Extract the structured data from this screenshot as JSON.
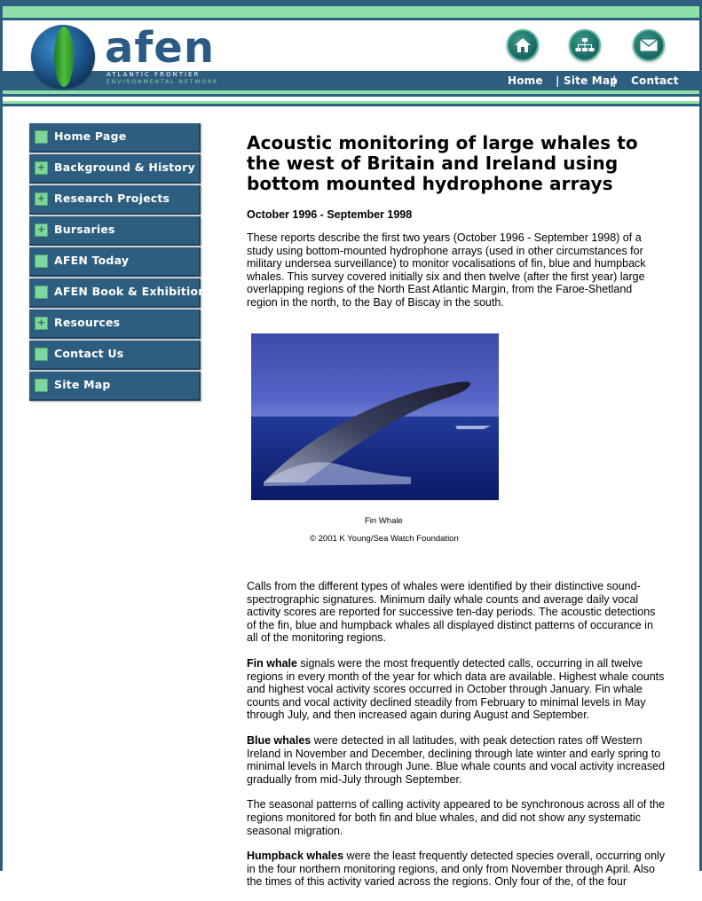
{
  "header": {
    "logo_text": "afen",
    "logo_sub1": "ATLANTIC FRONTIER",
    "logo_sub2": "ENVIRONMENTAL NETWORK",
    "icons": [
      "home-icon",
      "sitemap-icon",
      "mail-icon"
    ],
    "nav": {
      "home": "Home",
      "sep1": "|",
      "site_map": "Site Map",
      "sep2": "|",
      "contact": "Contact"
    },
    "colors": {
      "band": "#2e5e7f",
      "accent_green": "#8fe0a8"
    }
  },
  "sidebar": {
    "items": [
      {
        "label": "Home Page",
        "marker": ""
      },
      {
        "label": "Background & History",
        "marker": "+"
      },
      {
        "label": "Research Projects",
        "marker": "+"
      },
      {
        "label": "Bursaries",
        "marker": "+"
      },
      {
        "label": "AFEN Today",
        "marker": ""
      },
      {
        "label": "AFEN Book & Exhibition",
        "marker": ""
      },
      {
        "label": "Resources",
        "marker": "+"
      },
      {
        "label": "Contact Us",
        "marker": ""
      },
      {
        "label": "Site Map",
        "marker": ""
      }
    ]
  },
  "main": {
    "title": "Acoustic monitoring of large whales to the west of Britain and Ireland using bottom mounted hydrophone arrays",
    "date": "October 1996 - September 1998",
    "intro": "These reports describe the first two years (October 1996 - September 1998) of a study using bottom-mounted hydrophone arrays (used in other circumstances for military undersea surveillance) to monitor vocalisations of fin, blue and humpback whales. This survey covered initially six and then twelve (after the first year) large overlapping regions of the North East Atlantic Margin, from the Faroe-Shetland region in the north, to the Bay of Biscay in the south.",
    "image_caption": "Fin Whale",
    "image_credit": "© 2001 K Young/Sea Watch Foundation",
    "para1": "Calls from the different types of whales were identified by their distinctive sound-spectrographic signatures. Minimum daily whale counts and average daily vocal activity scores are reported for successive ten-day periods. The acoustic detections of the fin, blue and humpback whales all displayed distinct patterns of occurance in all of the monitoring regions.",
    "fin_bold": "Fin whale",
    "fin_text": " signals were the most frequently detected calls, occurring in all twelve regions in every month of the year for which data are available. Highest whale counts and highest vocal activity scores occurred in October through January. Fin whale counts and vocal activity declined steadily from February to minimal levels in May through July, and then increased again during August and September.",
    "blue_bold": "Blue whales",
    "blue_text": " were detected in all latitudes, with peak detection rates off Western Ireland in November and December, declining through late winter and early spring to minimal levels in March through June. Blue whale counts and vocal activity increased gradually from mid-July through September.",
    "para_seasonal": "The seasonal patterns of calling activity appeared to be synchronous across all of the regions monitored for both fin and blue whales, and did not show any systematic seasonal migration.",
    "hump_bold": "Humpback whales",
    "hump_text": " were the least frequently detected species overall, occurring only in the four northern monitoring regions, and only from November through April. Also the times of this activity varied across the regions. Only four of the, of the four"
  }
}
